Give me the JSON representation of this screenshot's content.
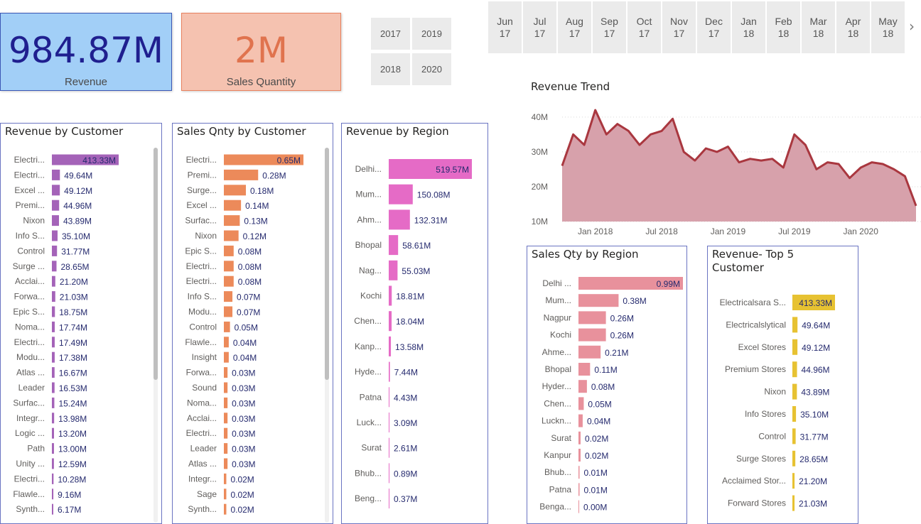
{
  "kpis": {
    "revenue": {
      "value": "984.87M",
      "label": "Revenue"
    },
    "quantity": {
      "value": "2M",
      "label": "Sales Quantity"
    }
  },
  "year_slicer": [
    "2017",
    "2019",
    "2018",
    "2020"
  ],
  "month_slicer": [
    {
      "m": "Jun",
      "y": "17"
    },
    {
      "m": "Jul",
      "y": "17"
    },
    {
      "m": "Aug",
      "y": "17"
    },
    {
      "m": "Sep",
      "y": "17"
    },
    {
      "m": "Oct",
      "y": "17"
    },
    {
      "m": "Nov",
      "y": "17"
    },
    {
      "m": "Dec",
      "y": "17"
    },
    {
      "m": "Jan",
      "y": "18"
    },
    {
      "m": "Feb",
      "y": "18"
    },
    {
      "m": "Mar",
      "y": "18"
    },
    {
      "m": "Apr",
      "y": "18"
    },
    {
      "m": "May",
      "y": "18"
    }
  ],
  "month_next_icon": "chevron-right-icon",
  "colors": {
    "revenue_customer": "#a463b8",
    "qty_customer": "#ec8a5a",
    "revenue_region": "#e56bc6",
    "qty_region": "#e8919c",
    "top5": "#e7c232",
    "trend_line": "#a9373f",
    "trend_fill": "#d7a1ab"
  },
  "chart_data": [
    {
      "type": "bar",
      "id": "rev-customer",
      "title": "Revenue by Customer",
      "categories": [
        "Electri...",
        "Electri...",
        "Excel ...",
        "Premi...",
        "Nixon",
        "Info S...",
        "Control",
        "Surge ...",
        "Acclai...",
        "Forwa...",
        "Epic S...",
        "Noma...",
        "Electri...",
        "Modu...",
        "Atlas ...",
        "Leader",
        "Surfac...",
        "Integr...",
        "Logic ...",
        "Path",
        "Unity ...",
        "Electri...",
        "Flawle...",
        "Synth..."
      ],
      "values": [
        413.33,
        49.64,
        49.12,
        44.96,
        43.89,
        35.1,
        31.77,
        28.65,
        21.2,
        21.03,
        18.75,
        17.74,
        17.49,
        17.38,
        16.67,
        16.53,
        15.24,
        13.98,
        13.2,
        13.0,
        12.59,
        10.28,
        9.16,
        6.17
      ],
      "labels": [
        "413.33M",
        "49.64M",
        "49.12M",
        "44.96M",
        "43.89M",
        "35.10M",
        "31.77M",
        "28.65M",
        "21.20M",
        "21.03M",
        "18.75M",
        "17.74M",
        "17.49M",
        "17.38M",
        "16.67M",
        "16.53M",
        "15.24M",
        "13.98M",
        "13.20M",
        "13.00M",
        "12.59M",
        "10.28M",
        "9.16M",
        "6.17M"
      ],
      "scrollbar": {
        "thumb_start": 0.0,
        "thumb_end": 0.62
      }
    },
    {
      "type": "bar",
      "id": "qty-customer",
      "title": "Sales Qnty by Customer",
      "categories": [
        "Electri...",
        "Premi...",
        "Surge...",
        "Excel ...",
        "Surfac...",
        "Nixon",
        "Epic S...",
        "Electri...",
        "Electri...",
        "Info S...",
        "Modu...",
        "Control",
        "Flawle...",
        "Insight",
        "Forwa...",
        "Sound",
        "Noma...",
        "Acclai...",
        "Electri...",
        "Leader",
        "Atlas ...",
        "Integr...",
        "Sage",
        "Synth..."
      ],
      "values": [
        0.65,
        0.28,
        0.18,
        0.14,
        0.13,
        0.12,
        0.08,
        0.08,
        0.08,
        0.07,
        0.07,
        0.05,
        0.04,
        0.04,
        0.03,
        0.03,
        0.03,
        0.03,
        0.03,
        0.03,
        0.03,
        0.02,
        0.02,
        0.02
      ],
      "labels": [
        "0.65M",
        "0.28M",
        "0.18M",
        "0.14M",
        "0.13M",
        "0.12M",
        "0.08M",
        "0.08M",
        "0.08M",
        "0.07M",
        "0.07M",
        "0.05M",
        "0.04M",
        "0.04M",
        "0.03M",
        "0.03M",
        "0.03M",
        "0.03M",
        "0.03M",
        "0.03M",
        "0.03M",
        "0.02M",
        "0.02M",
        "0.02M"
      ],
      "scrollbar": {
        "thumb_start": 0.0,
        "thumb_end": 0.62
      }
    },
    {
      "type": "bar",
      "id": "rev-region",
      "title": "Revenue by Region",
      "categories": [
        "Delhi...",
        "Mum...",
        "Ahm...",
        "Bhopal",
        "Nag...",
        "Kochi",
        "Chen...",
        "Kanp...",
        "Hyde...",
        "Patna",
        "Luck...",
        "Surat",
        "Bhub...",
        "Beng..."
      ],
      "values": [
        519.57,
        150.08,
        132.31,
        58.61,
        55.03,
        18.81,
        18.04,
        13.58,
        7.44,
        4.43,
        3.09,
        2.61,
        0.89,
        0.37
      ],
      "labels": [
        "519.57M",
        "150.08M",
        "132.31M",
        "58.61M",
        "55.03M",
        "18.81M",
        "18.04M",
        "13.58M",
        "7.44M",
        "4.43M",
        "3.09M",
        "2.61M",
        "0.89M",
        "0.37M"
      ]
    },
    {
      "type": "area",
      "id": "rev-trend",
      "title": "Revenue Trend",
      "x": [
        "2017-10",
        "2017-11",
        "2017-12",
        "2018-01",
        "2018-02",
        "2018-03",
        "2018-04",
        "2018-05",
        "2018-06",
        "2018-07",
        "2018-08",
        "2018-09",
        "2018-10",
        "2018-11",
        "2018-12",
        "2019-01",
        "2019-02",
        "2019-03",
        "2019-04",
        "2019-05",
        "2019-06",
        "2019-07",
        "2019-08",
        "2019-09",
        "2019-10",
        "2019-11",
        "2019-12",
        "2020-01",
        "2020-02",
        "2020-03",
        "2020-04",
        "2020-05",
        "2020-06"
      ],
      "values": [
        26,
        35,
        32,
        42,
        35,
        38,
        36,
        32,
        35,
        36,
        39.5,
        30,
        27.5,
        31,
        30,
        31.5,
        27,
        28,
        27.5,
        28,
        25.5,
        35,
        32,
        25,
        27,
        26.5,
        22.5,
        25.5,
        27,
        26.5,
        25,
        23,
        14.5
      ],
      "ylim": [
        10,
        42
      ],
      "y_ticks": [
        {
          "v": 10,
          "label": "10M"
        },
        {
          "v": 20,
          "label": "20M"
        },
        {
          "v": 30,
          "label": "30M"
        },
        {
          "v": 40,
          "label": "40M"
        }
      ],
      "x_ticks": [
        {
          "i": 3,
          "label": "Jan 2018"
        },
        {
          "i": 9,
          "label": "Jul 2018"
        },
        {
          "i": 15,
          "label": "Jan 2019"
        },
        {
          "i": 21,
          "label": "Jul 2019"
        },
        {
          "i": 27,
          "label": "Jan 2020"
        }
      ],
      "grid": true
    },
    {
      "type": "bar",
      "id": "qty-region",
      "title": "Sales Qty by Region",
      "categories": [
        "Delhi ...",
        "Mum...",
        "Nagpur",
        "Kochi",
        "Ahme...",
        "Bhopal",
        "Hyder...",
        "Chen...",
        "Luckn...",
        "Surat",
        "Kanpur",
        "Bhub...",
        "Patna",
        "Benga..."
      ],
      "values": [
        0.99,
        0.38,
        0.26,
        0.26,
        0.21,
        0.11,
        0.08,
        0.05,
        0.04,
        0.02,
        0.02,
        0.01,
        0.01,
        0.0
      ],
      "labels": [
        "0.99M",
        "0.38M",
        "0.26M",
        "0.26M",
        "0.21M",
        "0.11M",
        "0.08M",
        "0.05M",
        "0.04M",
        "0.02M",
        "0.02M",
        "0.01M",
        "0.01M",
        "0.00M"
      ]
    },
    {
      "type": "bar",
      "id": "top5",
      "title": "Revenue- Top 5 Customer",
      "categories": [
        "Electricalsara S...",
        "Electricalslytical",
        "Excel Stores",
        "Premium Stores",
        "Nixon",
        "Info Stores",
        "Control",
        "Surge Stores",
        "Acclaimed Stor...",
        "Forward Stores"
      ],
      "values": [
        413.33,
        49.64,
        49.12,
        44.96,
        43.89,
        35.1,
        31.77,
        28.65,
        21.2,
        21.03
      ],
      "labels": [
        "413.33M",
        "49.64M",
        "49.12M",
        "44.96M",
        "43.89M",
        "35.10M",
        "31.77M",
        "28.65M",
        "21.20M",
        "21.03M"
      ]
    }
  ]
}
